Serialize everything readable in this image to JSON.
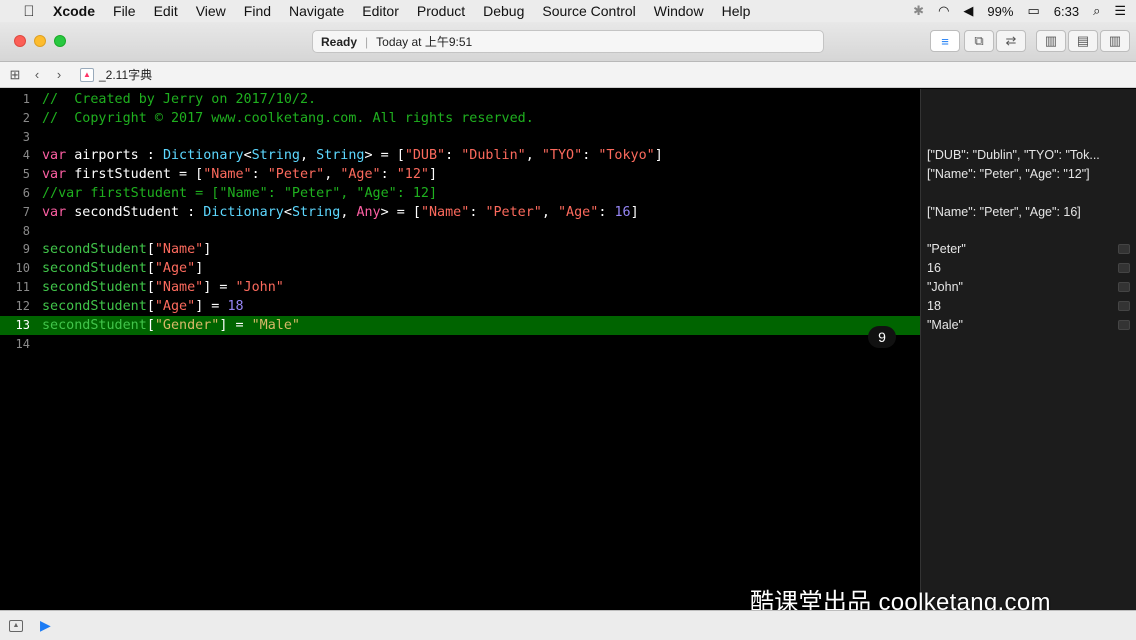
{
  "menubar": {
    "apple_icon": "apple-logo",
    "items": [
      "Xcode",
      "File",
      "Edit",
      "View",
      "Find",
      "Navigate",
      "Editor",
      "Product",
      "Debug",
      "Source Control",
      "Window",
      "Help"
    ],
    "battery": "99%",
    "time": "6:33"
  },
  "toolbar": {
    "status_state": "Ready",
    "status_time": "Today at 上午9:51"
  },
  "jumpbar": {
    "file_name": "_2.11字典"
  },
  "editor": {
    "current_line": 13,
    "badge": "9",
    "line_numbers": [
      "1",
      "2",
      "3",
      "4",
      "5",
      "6",
      "7",
      "8",
      "9",
      "10",
      "11",
      "12",
      "13",
      "14"
    ]
  },
  "results": {
    "line4": "[\"DUB\": \"Dublin\", \"TYO\": \"Tok...",
    "line5": "[\"Name\": \"Peter\", \"Age\": \"12\"]",
    "line7": "[\"Name\": \"Peter\", \"Age\": 16]",
    "line9": "\"Peter\"",
    "line10": "16",
    "line11": "\"John\"",
    "line12": "18",
    "line13": "\"Male\""
  },
  "watermark": "酷课堂出品 coolketang.com",
  "colors": {
    "comment": "#1fb01f",
    "keyword": "#fc5fa3",
    "type": "#5dd8ff",
    "string": "#fc6a5d",
    "number": "#9686f5",
    "variable": "#41c54a",
    "current_line_bg": "#006400"
  }
}
